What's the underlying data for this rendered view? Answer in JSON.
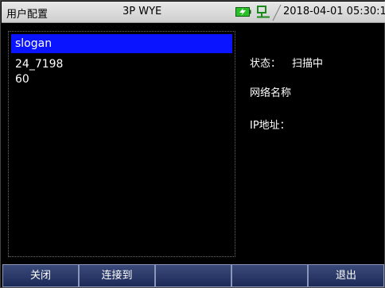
{
  "titlebar": {
    "title": "用户配置",
    "mode": "3P WYE",
    "datetime": "2018-04-01 05:30:18",
    "icons": [
      "battery-charging-icon",
      "network-icon"
    ]
  },
  "list": {
    "items": [
      {
        "label": "slogan",
        "selected": true
      },
      {
        "label": "24_7198",
        "selected": false
      },
      {
        "label": "60",
        "selected": false
      }
    ]
  },
  "info": {
    "status_label": "状态：",
    "status_value": "扫描中",
    "network_label": "网络名称",
    "ip_label": "IP地址："
  },
  "softkeys": [
    "关闭",
    "连接到",
    "",
    "",
    "退出"
  ],
  "colors": {
    "background": "#000000",
    "selection": "#0a14ff",
    "softkey": "#2a3868",
    "battery": "#2bbf2b",
    "network": "#1a8a1a"
  }
}
